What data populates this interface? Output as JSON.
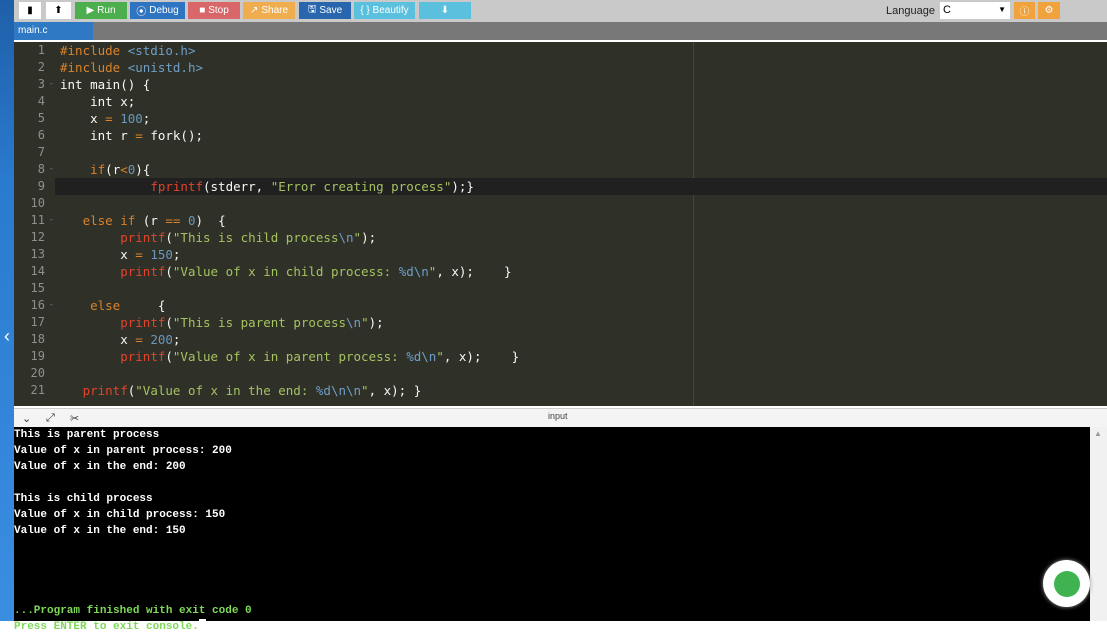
{
  "toolbar": {
    "new_icon": "file-icon",
    "upload_icon": "upload-icon",
    "run": "Run",
    "debug": "Debug",
    "stop": "Stop",
    "share": "Share",
    "save": "Save",
    "beautify": "{ } Beautify",
    "download_icon": "download-icon",
    "language_label": "Language",
    "language_value": "C",
    "info_icon": "info-icon",
    "settings_icon": "gear-icon"
  },
  "tabs": [
    {
      "label": "main.c"
    }
  ],
  "editor": {
    "lines": [
      [
        [
          "t-pp",
          "#include "
        ],
        [
          "t-hd",
          "<stdio.h>"
        ]
      ],
      [
        [
          "t-pp",
          "#include "
        ],
        [
          "t-hd",
          "<unistd.h>"
        ]
      ],
      [
        [
          "t-kw",
          "int main() {"
        ]
      ],
      [
        [
          "t-kw",
          "    int x;"
        ]
      ],
      [
        [
          "t-tx",
          "    x "
        ],
        [
          "t-op",
          "="
        ],
        [
          "t-tx",
          " "
        ],
        [
          "t-num",
          "100"
        ],
        [
          "t-tx",
          ";"
        ]
      ],
      [
        [
          "t-kw",
          "    int r "
        ],
        [
          "t-op",
          "="
        ],
        [
          "t-tx",
          " fork();"
        ]
      ],
      [],
      [
        [
          "t-tx",
          "    "
        ],
        [
          "t-op",
          "if"
        ],
        [
          "t-tx",
          "(r"
        ],
        [
          "t-op",
          "<"
        ],
        [
          "t-num",
          "0"
        ],
        [
          "t-tx",
          "){"
        ]
      ],
      [
        [
          "t-tx",
          "            "
        ],
        [
          "t-fn",
          "fprintf"
        ],
        [
          "t-tx",
          "(stderr, "
        ],
        [
          "t-str",
          "\"Error creating process\""
        ],
        [
          "t-tx",
          ");}"
        ]
      ],
      [],
      [
        [
          "t-tx",
          "   "
        ],
        [
          "t-op",
          "else if"
        ],
        [
          "t-tx",
          " (r "
        ],
        [
          "t-op",
          "=="
        ],
        [
          "t-tx",
          " "
        ],
        [
          "t-num",
          "0"
        ],
        [
          "t-tx",
          ")  {"
        ]
      ],
      [
        [
          "t-tx",
          "        "
        ],
        [
          "t-fn",
          "printf"
        ],
        [
          "t-tx",
          "("
        ],
        [
          "t-str",
          "\"This is child process"
        ],
        [
          "t-esc",
          "\\n"
        ],
        [
          "t-str",
          "\""
        ],
        [
          "t-tx",
          ");"
        ]
      ],
      [
        [
          "t-tx",
          "        x "
        ],
        [
          "t-op",
          "="
        ],
        [
          "t-tx",
          " "
        ],
        [
          "t-num",
          "150"
        ],
        [
          "t-tx",
          ";"
        ]
      ],
      [
        [
          "t-tx",
          "        "
        ],
        [
          "t-fn",
          "printf"
        ],
        [
          "t-tx",
          "("
        ],
        [
          "t-str",
          "\"Value of x in child process: "
        ],
        [
          "t-esc",
          "%d\\n"
        ],
        [
          "t-str",
          "\""
        ],
        [
          "t-tx",
          ", x);    }"
        ]
      ],
      [],
      [
        [
          "t-tx",
          "    "
        ],
        [
          "t-op",
          "else"
        ],
        [
          "t-tx",
          "     {"
        ]
      ],
      [
        [
          "t-tx",
          "        "
        ],
        [
          "t-fn",
          "printf"
        ],
        [
          "t-tx",
          "("
        ],
        [
          "t-str",
          "\"This is parent process"
        ],
        [
          "t-esc",
          "\\n"
        ],
        [
          "t-str",
          "\""
        ],
        [
          "t-tx",
          ");"
        ]
      ],
      [
        [
          "t-tx",
          "        x "
        ],
        [
          "t-op",
          "="
        ],
        [
          "t-tx",
          " "
        ],
        [
          "t-num",
          "200"
        ],
        [
          "t-tx",
          ";"
        ]
      ],
      [
        [
          "t-tx",
          "        "
        ],
        [
          "t-fn",
          "printf"
        ],
        [
          "t-tx",
          "("
        ],
        [
          "t-str",
          "\"Value of x in parent process: "
        ],
        [
          "t-esc",
          "%d\\n"
        ],
        [
          "t-str",
          "\""
        ],
        [
          "t-tx",
          ", x);    }"
        ]
      ],
      [],
      [
        [
          "t-tx",
          "   "
        ],
        [
          "t-fn",
          "printf"
        ],
        [
          "t-tx",
          "("
        ],
        [
          "t-str",
          "\"Value of x in the end: "
        ],
        [
          "t-esc",
          "%d\\n\\n"
        ],
        [
          "t-str",
          "\""
        ],
        [
          "t-tx",
          ", x); }"
        ]
      ]
    ],
    "fold_lines": [
      3,
      8,
      11,
      16
    ],
    "active_line": 9
  },
  "console": {
    "header_label": "input",
    "output": [
      "This is parent process",
      "Value of x in parent process: 200",
      "Value of x in the end: 200",
      "",
      "This is child process",
      "Value of x in child process: 150",
      "Value of x in the end: 150",
      "",
      "",
      "",
      ""
    ],
    "finished": "...Program finished with exit code 0",
    "prompt": "Press ENTER to exit console."
  }
}
